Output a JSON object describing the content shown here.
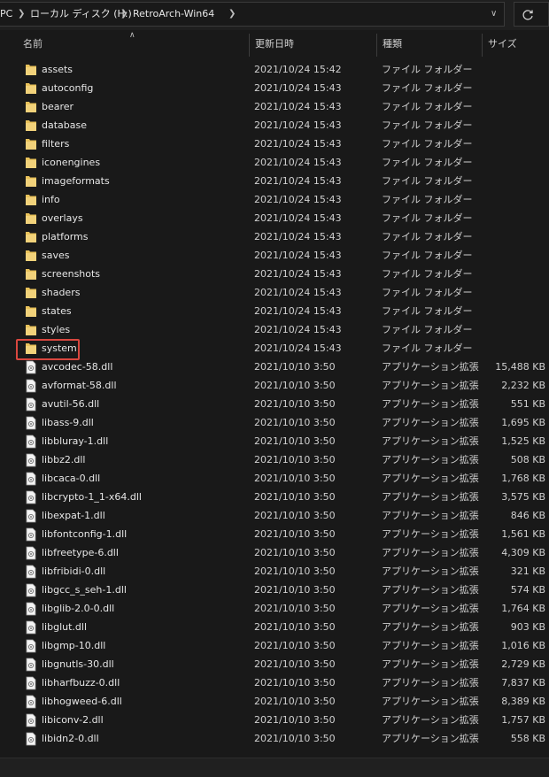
{
  "address": {
    "crumbs": [
      "PC",
      "ローカル ディスク (H:)",
      "RetroArch-Win64"
    ]
  },
  "columns": {
    "name": "名前",
    "date": "更新日時",
    "type": "種類",
    "size": "サイズ"
  },
  "colors": {
    "folder": "#e8c15a",
    "highlight_border": "#d9473f",
    "background": "#191919"
  },
  "highlighted_item": "system",
  "rows": [
    {
      "name": "assets",
      "date": "2021/10/24 15:42",
      "type": "ファイル フォルダー",
      "size": "",
      "kind": "folder"
    },
    {
      "name": "autoconfig",
      "date": "2021/10/24 15:43",
      "type": "ファイル フォルダー",
      "size": "",
      "kind": "folder"
    },
    {
      "name": "bearer",
      "date": "2021/10/24 15:43",
      "type": "ファイル フォルダー",
      "size": "",
      "kind": "folder"
    },
    {
      "name": "database",
      "date": "2021/10/24 15:43",
      "type": "ファイル フォルダー",
      "size": "",
      "kind": "folder"
    },
    {
      "name": "filters",
      "date": "2021/10/24 15:43",
      "type": "ファイル フォルダー",
      "size": "",
      "kind": "folder"
    },
    {
      "name": "iconengines",
      "date": "2021/10/24 15:43",
      "type": "ファイル フォルダー",
      "size": "",
      "kind": "folder"
    },
    {
      "name": "imageformats",
      "date": "2021/10/24 15:43",
      "type": "ファイル フォルダー",
      "size": "",
      "kind": "folder"
    },
    {
      "name": "info",
      "date": "2021/10/24 15:43",
      "type": "ファイル フォルダー",
      "size": "",
      "kind": "folder"
    },
    {
      "name": "overlays",
      "date": "2021/10/24 15:43",
      "type": "ファイル フォルダー",
      "size": "",
      "kind": "folder"
    },
    {
      "name": "platforms",
      "date": "2021/10/24 15:43",
      "type": "ファイル フォルダー",
      "size": "",
      "kind": "folder"
    },
    {
      "name": "saves",
      "date": "2021/10/24 15:43",
      "type": "ファイル フォルダー",
      "size": "",
      "kind": "folder"
    },
    {
      "name": "screenshots",
      "date": "2021/10/24 15:43",
      "type": "ファイル フォルダー",
      "size": "",
      "kind": "folder"
    },
    {
      "name": "shaders",
      "date": "2021/10/24 15:43",
      "type": "ファイル フォルダー",
      "size": "",
      "kind": "folder"
    },
    {
      "name": "states",
      "date": "2021/10/24 15:43",
      "type": "ファイル フォルダー",
      "size": "",
      "kind": "folder"
    },
    {
      "name": "styles",
      "date": "2021/10/24 15:43",
      "type": "ファイル フォルダー",
      "size": "",
      "kind": "folder"
    },
    {
      "name": "system",
      "date": "2021/10/24 15:43",
      "type": "ファイル フォルダー",
      "size": "",
      "kind": "folder"
    },
    {
      "name": "avcodec-58.dll",
      "date": "2021/10/10 3:50",
      "type": "アプリケーション拡張",
      "size": "15,488 KB",
      "kind": "dll"
    },
    {
      "name": "avformat-58.dll",
      "date": "2021/10/10 3:50",
      "type": "アプリケーション拡張",
      "size": "2,232 KB",
      "kind": "dll"
    },
    {
      "name": "avutil-56.dll",
      "date": "2021/10/10 3:50",
      "type": "アプリケーション拡張",
      "size": "551 KB",
      "kind": "dll"
    },
    {
      "name": "libass-9.dll",
      "date": "2021/10/10 3:50",
      "type": "アプリケーション拡張",
      "size": "1,695 KB",
      "kind": "dll"
    },
    {
      "name": "libbluray-1.dll",
      "date": "2021/10/10 3:50",
      "type": "アプリケーション拡張",
      "size": "1,525 KB",
      "kind": "dll"
    },
    {
      "name": "libbz2.dll",
      "date": "2021/10/10 3:50",
      "type": "アプリケーション拡張",
      "size": "508 KB",
      "kind": "dll"
    },
    {
      "name": "libcaca-0.dll",
      "date": "2021/10/10 3:50",
      "type": "アプリケーション拡張",
      "size": "1,768 KB",
      "kind": "dll"
    },
    {
      "name": "libcrypto-1_1-x64.dll",
      "date": "2021/10/10 3:50",
      "type": "アプリケーション拡張",
      "size": "3,575 KB",
      "kind": "dll"
    },
    {
      "name": "libexpat-1.dll",
      "date": "2021/10/10 3:50",
      "type": "アプリケーション拡張",
      "size": "846 KB",
      "kind": "dll"
    },
    {
      "name": "libfontconfig-1.dll",
      "date": "2021/10/10 3:50",
      "type": "アプリケーション拡張",
      "size": "1,561 KB",
      "kind": "dll"
    },
    {
      "name": "libfreetype-6.dll",
      "date": "2021/10/10 3:50",
      "type": "アプリケーション拡張",
      "size": "4,309 KB",
      "kind": "dll"
    },
    {
      "name": "libfribidi-0.dll",
      "date": "2021/10/10 3:50",
      "type": "アプリケーション拡張",
      "size": "321 KB",
      "kind": "dll"
    },
    {
      "name": "libgcc_s_seh-1.dll",
      "date": "2021/10/10 3:50",
      "type": "アプリケーション拡張",
      "size": "574 KB",
      "kind": "dll"
    },
    {
      "name": "libglib-2.0-0.dll",
      "date": "2021/10/10 3:50",
      "type": "アプリケーション拡張",
      "size": "1,764 KB",
      "kind": "dll"
    },
    {
      "name": "libglut.dll",
      "date": "2021/10/10 3:50",
      "type": "アプリケーション拡張",
      "size": "903 KB",
      "kind": "dll"
    },
    {
      "name": "libgmp-10.dll",
      "date": "2021/10/10 3:50",
      "type": "アプリケーション拡張",
      "size": "1,016 KB",
      "kind": "dll"
    },
    {
      "name": "libgnutls-30.dll",
      "date": "2021/10/10 3:50",
      "type": "アプリケーション拡張",
      "size": "2,729 KB",
      "kind": "dll"
    },
    {
      "name": "libharfbuzz-0.dll",
      "date": "2021/10/10 3:50",
      "type": "アプリケーション拡張",
      "size": "7,837 KB",
      "kind": "dll"
    },
    {
      "name": "libhogweed-6.dll",
      "date": "2021/10/10 3:50",
      "type": "アプリケーション拡張",
      "size": "8,389 KB",
      "kind": "dll"
    },
    {
      "name": "libiconv-2.dll",
      "date": "2021/10/10 3:50",
      "type": "アプリケーション拡張",
      "size": "1,757 KB",
      "kind": "dll"
    },
    {
      "name": "libidn2-0.dll",
      "date": "2021/10/10 3:50",
      "type": "アプリケーション拡張",
      "size": "558 KB",
      "kind": "dll"
    }
  ]
}
